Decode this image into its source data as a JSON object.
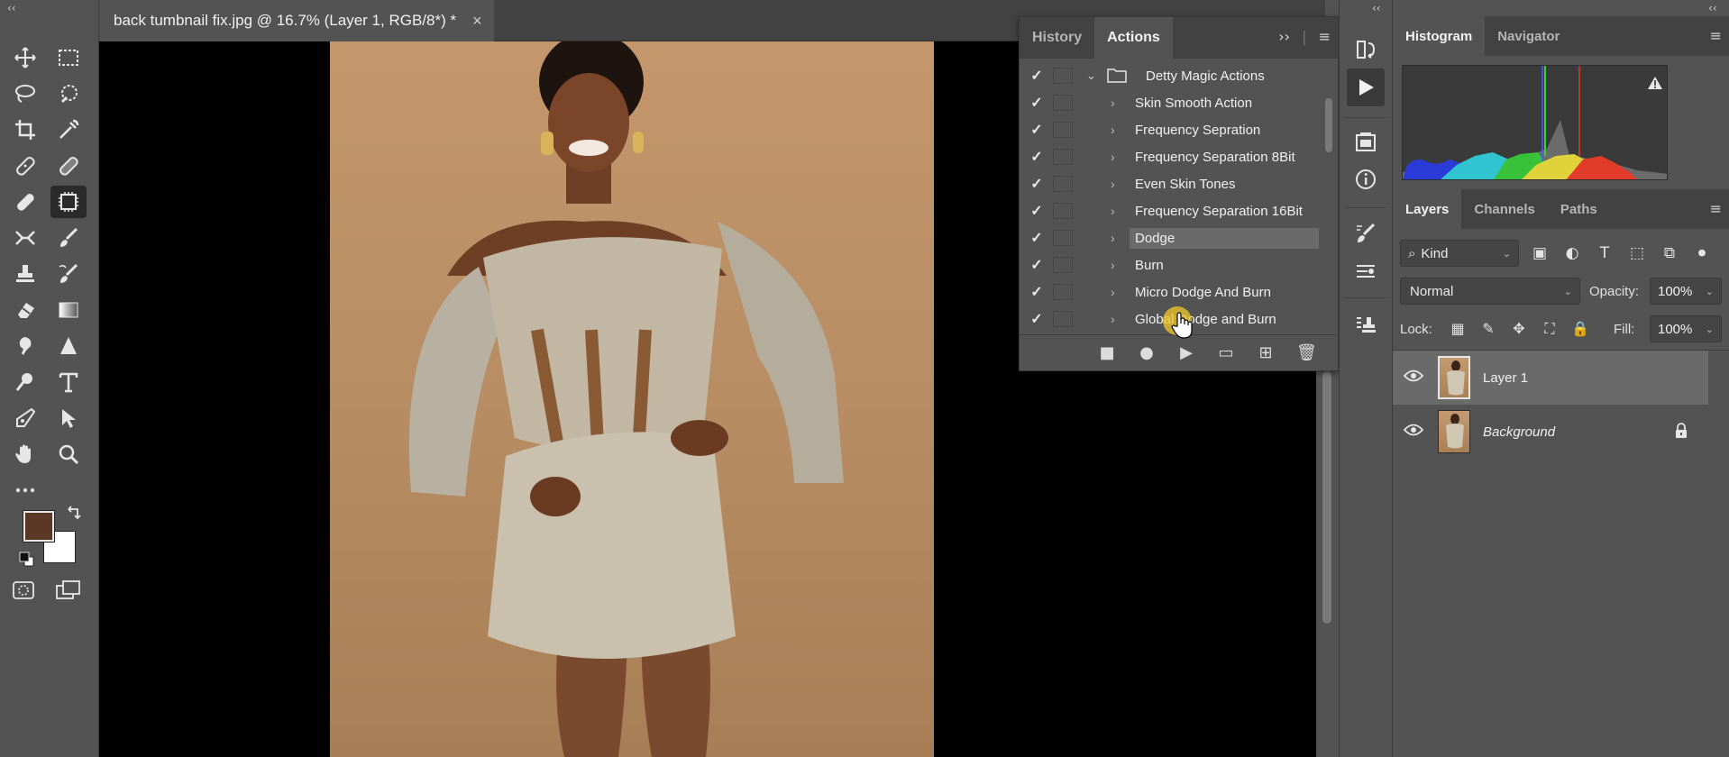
{
  "document": {
    "tab_title": "back tumbnail fix.jpg @ 16.7% (Layer 1, RGB/8*) *",
    "close_glyph": "×"
  },
  "toolbar": {
    "collapse_glyph": "‹‹",
    "tools": [
      "move-tool",
      "marquee-tool",
      "lasso-tool",
      "quick-select-tool",
      "crop-tool",
      "eyedropper-tool",
      "spot-healing-tool",
      "patch-tool",
      "bandage-tool",
      "content-aware-move-tool",
      "remove-tool",
      "brush-tool",
      "stamp-tool",
      "history-brush-tool",
      "eraser-tool",
      "gradient-tool",
      "smudge-tool",
      "sharpen-tool",
      "dodge-tool",
      "type-tool",
      "pen-tool",
      "path-select-tool",
      "hand-tool",
      "zoom-tool",
      "more-tools"
    ],
    "foreground_color": "#5b3826",
    "background_color": "#ffffff"
  },
  "actions_panel": {
    "tabs": [
      "History",
      "Actions"
    ],
    "active_tab": "Actions",
    "expand_glyph": "››",
    "menu_glyph": "≡",
    "folder": {
      "name": "Detty Magic Actions",
      "checked": true
    },
    "items": [
      {
        "label": "Skin Smooth Action",
        "checked": true
      },
      {
        "label": "Frequency Sepration",
        "checked": true
      },
      {
        "label": "Frequency Separation 8Bit",
        "checked": true
      },
      {
        "label": "Even Skin Tones",
        "checked": true
      },
      {
        "label": "Frequency Separation 16Bit",
        "checked": true
      },
      {
        "label": "Dodge",
        "checked": true,
        "selected": true
      },
      {
        "label": "Burn",
        "checked": true
      },
      {
        "label": "Micro Dodge And Burn",
        "checked": true
      },
      {
        "label": "Global Dodge and Burn",
        "checked": true
      }
    ],
    "bottom_buttons": [
      "stop-icon",
      "record-icon",
      "play-icon",
      "folder-icon",
      "new-action-icon",
      "trash-icon"
    ]
  },
  "right_panel": {
    "collapse_glyph": "‹‹",
    "top_tabs": [
      "Histogram",
      "Navigator"
    ],
    "active_top_tab": "Histogram",
    "layer_tabs": [
      "Layers",
      "Channels",
      "Paths"
    ],
    "active_layer_tab": "Layers",
    "kind_filter": "Kind",
    "blend_mode": "Normal",
    "opacity_label": "Opacity:",
    "opacity": "100%",
    "lock_label": "Lock:",
    "fill_label": "Fill:",
    "fill": "100%",
    "layers": [
      {
        "name": "Layer 1",
        "selected": true,
        "italic": false,
        "locked": false
      },
      {
        "name": "Background",
        "selected": false,
        "italic": true,
        "locked": true
      }
    ]
  },
  "colors": {
    "panel_bg": "#535353",
    "tab_bar": "#424242",
    "selection": "#6a6a6a",
    "canvas_bg": "#000000"
  }
}
